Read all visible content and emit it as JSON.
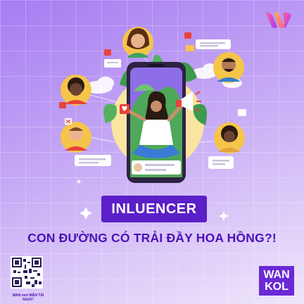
{
  "headline": "INLUENCER",
  "subheadline": "CON ĐƯỜNG CÓ TRẢI ĐẦY HOA HỒNG?!",
  "qr_caption": "WAN mời MẬN TẢI NGAY!",
  "brand_badge": {
    "line1": "WAN",
    "line2": "KOL"
  },
  "colors": {
    "background_top": "#a77cf2",
    "headline_bg": "#5b1fc7",
    "accent_text": "#4a11b8",
    "brand_bg": "#6a2ad6",
    "sun": "#f9e4a0"
  },
  "icons": [
    "logo-icon",
    "qr-code-icon",
    "megaphone-icon",
    "heart-icon",
    "sparkle-icon",
    "chat-bubble-icon",
    "avatar-icon"
  ]
}
